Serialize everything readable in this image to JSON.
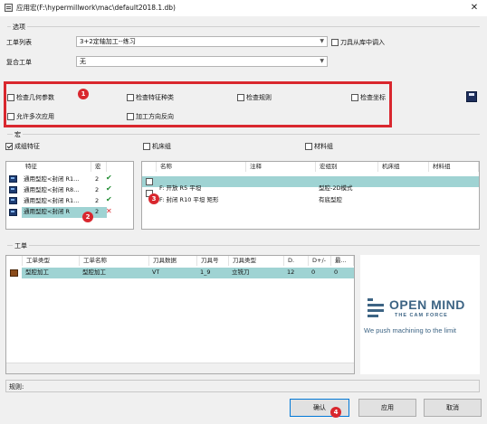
{
  "window": {
    "title": "应用宏(F:\\hypermillwork\\mac\\default2018.1.db)",
    "close_glyph": "✕"
  },
  "options": {
    "group_label": "选项",
    "joblist_label": "工单列表",
    "joblist_value": "3+2定轴加工--练习",
    "tool_from_lib_label": "刀具从库中调入",
    "compound_label": "复合工单",
    "compound_value": "无",
    "checks": {
      "geometry_params": "检查几何参数",
      "feature_type": "检查特征种类",
      "rules": "检查规则",
      "coordinates": "检查坐标",
      "allow_multi": "允许多次应用",
      "reverse_dir": "加工方向反向"
    }
  },
  "macro": {
    "group_label": "宏",
    "group_feature_label": "成组特征",
    "machine_group_label": "机床组",
    "material_group_label": "材料组",
    "feature_table": {
      "headers": [
        "特征",
        "宏"
      ],
      "rows": [
        {
          "name": "通用型腔<封闭 R1...",
          "count": "2",
          "status": "ok"
        },
        {
          "name": "通用型腔<封闭 R8...",
          "count": "2",
          "status": "ok"
        },
        {
          "name": "通用型腔<封闭 R1...",
          "count": "2",
          "status": "ok"
        },
        {
          "name": "通用型腔<封闭 R",
          "count": "2",
          "status": "fail"
        }
      ]
    },
    "macro_table": {
      "headers": [
        "名称",
        "注释",
        "宏组别",
        "机床组",
        "材料组"
      ],
      "rows": [
        {
          "name": "F: 开放 R5 平坦",
          "comment": "",
          "group": "型腔-2D模式",
          "machine": "",
          "material": ""
        },
        {
          "name": "F: 封闭 R10 平坦 矩形",
          "comment": "",
          "group": "有底型腔",
          "machine": "",
          "material": ""
        }
      ]
    }
  },
  "jobs": {
    "group_label": "工单",
    "headers": [
      "工单类型",
      "工单名称",
      "刀具数据",
      "刀具号",
      "刀具类型",
      "D.",
      "D+/-",
      "最..."
    ],
    "rows": [
      {
        "type": "型腔加工",
        "name": "型腔加工",
        "tooldata": "VT",
        "toolno": "1_9",
        "tooltype": "立铣刀",
        "d": "12",
        "dpm": "0",
        "max": "0"
      }
    ]
  },
  "logo": {
    "brand": "OPEN MIND",
    "subtitle": "THE CAM FORCE",
    "tagline": "We push machining to the limit"
  },
  "rules_label": "规则:",
  "buttons": {
    "confirm": "确认",
    "apply": "应用",
    "cancel": "取消"
  },
  "markers": [
    "1",
    "2",
    "3",
    "4"
  ],
  "colors": {
    "highlight": "#d9272e",
    "row_selected": "#9fd3d3",
    "logo_blue": "#3d6484"
  }
}
